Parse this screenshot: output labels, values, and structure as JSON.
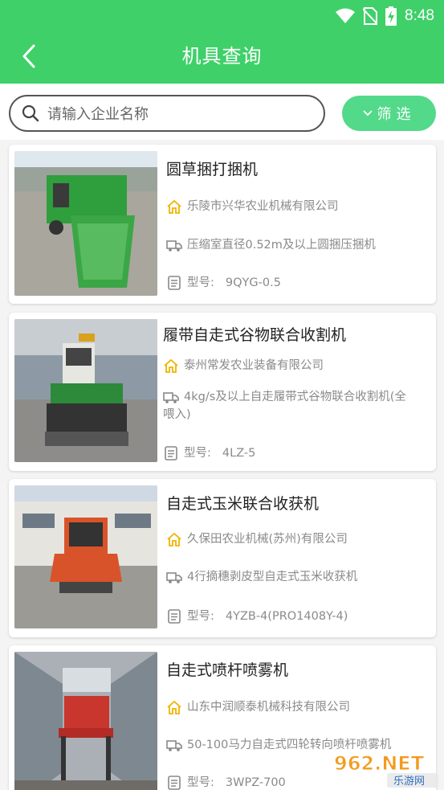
{
  "status": {
    "time": "8:48"
  },
  "header": {
    "title": "机具查询"
  },
  "search": {
    "placeholder": "请输入企业名称"
  },
  "filter": {
    "label": "筛选"
  },
  "items": [
    {
      "name": "圆草捆打捆机",
      "company": "乐陵市兴华农业机械有限公司",
      "desc": "压缩室直径0.52m及以上圆捆压捆机",
      "model_label": "型号:",
      "model": "9QYG-0.5"
    },
    {
      "name": "履带自走式谷物联合收割机",
      "company": "泰州常发农业装备有限公司",
      "desc": "4kg/s及以上自走履带式谷物联合收割机(全喂入)",
      "model_label": "型号:",
      "model": "4LZ-5"
    },
    {
      "name": "自走式玉米联合收获机",
      "company": "久保田农业机械(苏州)有限公司",
      "desc": "4行摘穗剥皮型自走式玉米收获机",
      "model_label": "型号:",
      "model": "4YZB-4(PRO1408Y-4)"
    },
    {
      "name": "自走式喷杆喷雾机",
      "company": "山东中润顺泰机械科技有限公司",
      "desc": "50-100马力自走式四轮转向喷杆喷雾机",
      "model_label": "型号:",
      "model": "3WPZ-700"
    }
  ],
  "watermark": {
    "brand": "962.NET",
    "sub": "乐游网"
  },
  "colors": {
    "header": "#3fd06a",
    "filter": "#52d98a",
    "company_icon": "#f0b400"
  }
}
